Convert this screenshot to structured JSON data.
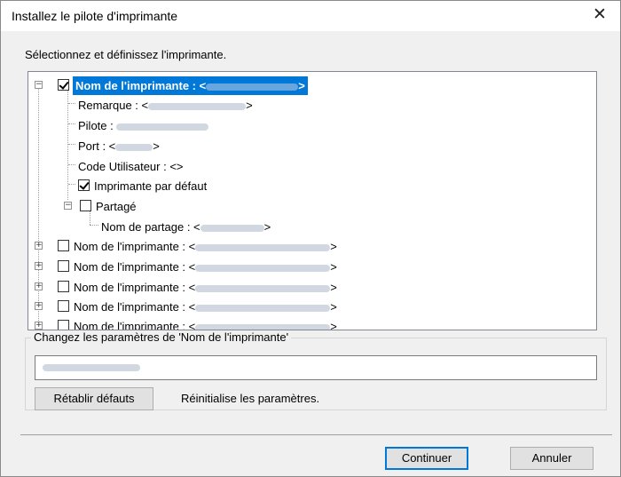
{
  "window": {
    "title": "Installez le pilote d'imprimante"
  },
  "instruction": "Sélectionnez et définissez l'imprimante.",
  "tree": {
    "root": {
      "label": "Nom de l'imprimante : <",
      "close": ">",
      "checked": true
    },
    "remarque": {
      "label": "Remarque : <",
      "close": ">"
    },
    "pilote": {
      "label": "Pilote : "
    },
    "port": {
      "label": "Port : <",
      "close": ">"
    },
    "code": {
      "label": "Code Utilisateur : <>"
    },
    "defaut": {
      "label": "Imprimante par défaut",
      "checked": true
    },
    "partage": {
      "label": "Partagé",
      "checked": false
    },
    "nom_partage": {
      "label": "Nom de partage : <",
      "close": ">"
    },
    "others": [
      {
        "label": "Nom de l'imprimante : <",
        "close": ">"
      },
      {
        "label": "Nom de l'imprimante : <",
        "close": ">"
      },
      {
        "label": "Nom de l'imprimante : <",
        "close": ">"
      },
      {
        "label": "Nom de l'imprimante : <",
        "close": ">"
      },
      {
        "label": "Nom de l'imprimante : <",
        "close": ">"
      }
    ]
  },
  "settings": {
    "legend": "Changez les paramètres de 'Nom de l'imprimante'",
    "reset_button": "Rétablir défauts",
    "reset_desc": "Réinitialise les paramètres."
  },
  "footer": {
    "continue": "Continuer",
    "cancel": "Annuler"
  },
  "icons": {
    "close": "close-icon",
    "collapse": "minus-box-icon",
    "expand": "plus-box-icon",
    "check": "checkmark-icon"
  },
  "colors": {
    "selection": "#0078d7",
    "window_bg": "#f0f0f0"
  }
}
